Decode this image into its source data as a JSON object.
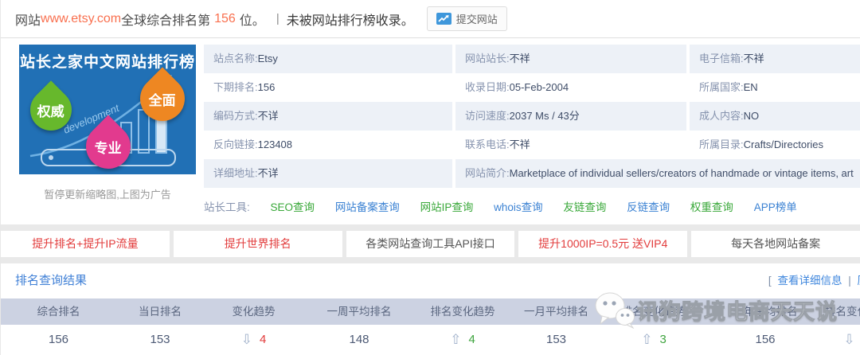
{
  "topbar": {
    "prefix": "网站",
    "domain": "www.etsy.com",
    "rank_label": "全球综合排名第",
    "rank": "156",
    "rank_suffix": "位。",
    "pipe": "|",
    "status": "未被网站排行榜收录。",
    "submit_button": "提交网站"
  },
  "banner": {
    "title": "站长之家中文网站排行榜",
    "badges": [
      "权威",
      "全面",
      "专业"
    ],
    "dev_text": "development",
    "caption": "暂停更新缩略图,上图为广告",
    "colors": {
      "bg": "#2170b5",
      "green": "#67b82c",
      "orange": "#ee8722",
      "pink": "#e23a8e"
    }
  },
  "info": {
    "rows": [
      [
        {
          "label": "站点名称:",
          "value": "Etsy"
        },
        {
          "label": "网站站长:",
          "value": "不祥"
        },
        {
          "label": "电子信箱:",
          "value": "不祥"
        }
      ],
      [
        {
          "label": "下期排名:",
          "value": "156"
        },
        {
          "label": "收录日期:",
          "value": "05-Feb-2004"
        },
        {
          "label": "所属国家:",
          "value": "EN"
        }
      ],
      [
        {
          "label": "编码方式:",
          "value": "不详"
        },
        {
          "label": "访问速度:",
          "value": "2037 Ms / 43分"
        },
        {
          "label": "成人内容:",
          "value": "NO"
        }
      ],
      [
        {
          "label": "反向链接:",
          "value": "123408"
        },
        {
          "label": "联系电话:",
          "value": "不祥"
        },
        {
          "label": "所属目录:",
          "value": "Crafts/Directories"
        }
      ],
      [
        {
          "label": "详细地址:",
          "value": "不详"
        },
        {
          "label": "网站简介:",
          "value": "Marketplace of individual sellers/creators of handmade or vintage items, art"
        }
      ]
    ]
  },
  "tools": {
    "label": "站长工具:",
    "links": [
      "SEO查询",
      "网站备案查询",
      "网站IP查询",
      "whois查询",
      "友链查询",
      "反链查询",
      "权重查询",
      "APP榜单"
    ]
  },
  "promos": [
    "提升排名+提升IP流量",
    "提升世界排名",
    "各类网站查询工具API接口",
    "提升1000IP=0.5元 送VIP4",
    "每天各地网站备案"
  ],
  "result": {
    "title": "排名查询结果",
    "bracket": "[",
    "detail_link": "查看详细信息",
    "pipe": "|",
    "history_link": "历",
    "table": {
      "headers": [
        "综合排名",
        "当日排名",
        "变化趋势",
        "一周平均排名",
        "排名变化趋势",
        "一月平均排名",
        "排名变化趋势",
        "一年平均排名",
        "排名变化趋势"
      ],
      "row": {
        "overall": "156",
        "today": "153",
        "trend1_glyph": "⇩",
        "trend1_num": "4",
        "week_avg": "148",
        "trend2_glyph": "⇧",
        "trend2_num": "4",
        "month_avg": "153",
        "trend3_glyph": "⇧",
        "trend3_num": "3",
        "year_avg": "156",
        "trend4_glyph": "⇩"
      }
    }
  },
  "watermark": {
    "text": "讯狗跨境电商天天说"
  }
}
